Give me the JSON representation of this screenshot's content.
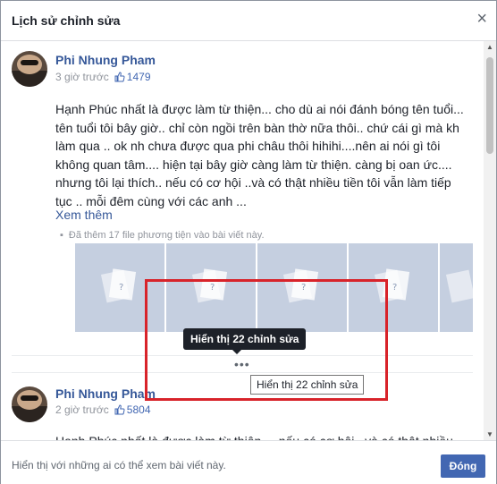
{
  "dialog": {
    "title": "Lịch sử chỉnh sửa",
    "close_icon": "×"
  },
  "post1": {
    "author": "Phi Nhung Pham",
    "time": "3 giờ trước",
    "like_count": "1479",
    "text": "Hạnh Phúc nhất là được làm từ thiện... cho dù ai nói đánh bóng tên tuổi... tên tuổi tôi bây giờ.. chỉ còn ngồi trên bàn thờ nữa thôi.. chứ cái gì mà kh làm qua .. ok nh chưa được qua phi châu thôi hihihi....nên ai nói gì tôi không quan tâm.... hiện tại bây giờ càng làm từ thiện. càng bị oan ức.... nhưng tôi lại thích.. nếu có cơ hội ..và có thật nhiều tiền tôi vẫn làm tiếp tục .. mỗi đêm cùng với các anh ...",
    "see_more": "Xem thêm",
    "media_note": "Đã thêm 17 file phương tiện vào bài viết này."
  },
  "edits": {
    "dots": "•••",
    "tooltip_dark": "Hiển thị 22 chỉnh sửa",
    "tooltip_light": "Hiển thị 22 chỉnh sửa"
  },
  "post2": {
    "author": "Phi Nhung Pham",
    "time": "2 giờ trước",
    "like_count": "5804",
    "text": "Hạnh Phúc nhất là được làm từ thiện ... nếu có cơ hội ..và có thật nhiều"
  },
  "footer": {
    "text": "Hiển thị với những ai có thể xem bài viết này.",
    "close_button": "Đóng"
  },
  "colors": {
    "link": "#365899",
    "button": "#4267b2",
    "highlight": "#d8232a"
  }
}
